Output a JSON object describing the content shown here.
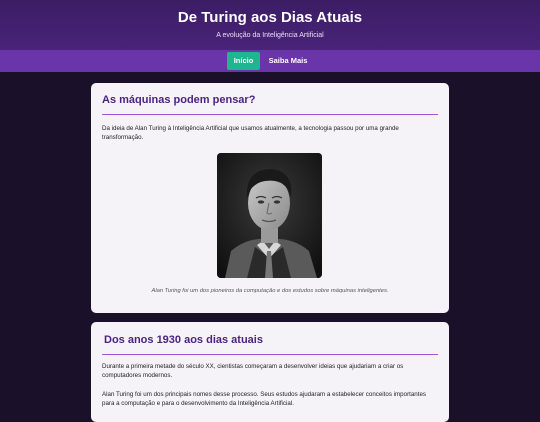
{
  "header": {
    "title": "De Turing aos Dias Atuais",
    "subtitle": "A evolução da Inteligência Artificial"
  },
  "nav": {
    "items": [
      {
        "label": "Início",
        "active": true
      },
      {
        "label": "Saiba Mais",
        "active": false
      }
    ],
    "active_color": "#1fb58f"
  },
  "sections": [
    {
      "title": "As máquinas podem pensar?",
      "paragraphs": [
        "Da ideia de Alan Turing à Inteligência Artificial que usamos atualmente, a tecnologia passou por uma grande transformação."
      ],
      "image_alt": "Alan Turing",
      "caption": "Alan Turing foi um dos pioneiros da computação e dos estudos sobre máquinas inteligentes."
    },
    {
      "title": "Dos anos 1930 aos dias atuais",
      "paragraphs": [
        "Durante a primeira metade do século XX, cientistas começaram a desenvolver ideias que ajudariam a criar os computadores modernos.",
        "Alan Turing foi um dos principais nomes desse processo. Seus estudos ajudaram a estabelecer conceitos importantes para a computação e para o desenvolvimento da Inteligência Artificial."
      ]
    }
  ],
  "colors": {
    "header": "#3b1d63",
    "nav": "#6a35a8",
    "title": "#4b2380",
    "background": "#1a1029"
  }
}
